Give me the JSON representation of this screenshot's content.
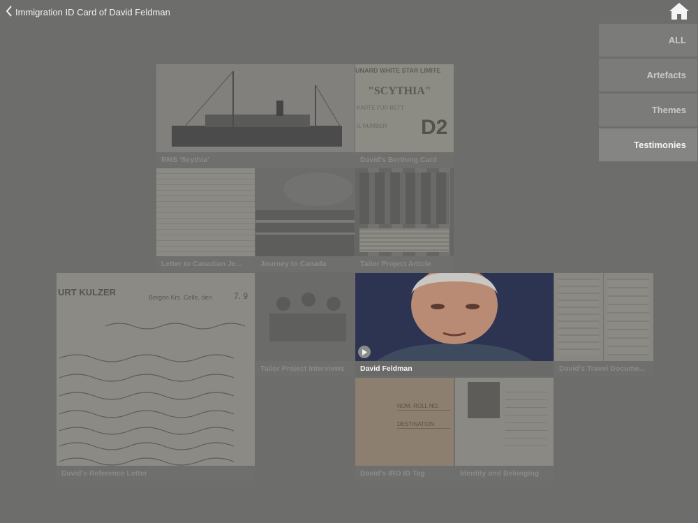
{
  "header": {
    "title": "Immigration ID Card of David Feldman",
    "back_icon": "chevron-left-icon",
    "home_icon": "home-icon"
  },
  "filters": [
    {
      "label": "ALL",
      "active": false
    },
    {
      "label": "Artefacts",
      "active": false
    },
    {
      "label": "Themes",
      "active": false
    },
    {
      "label": "Testimonies",
      "active": true
    }
  ],
  "tiles": {
    "rms_scythia": "RMS 'Scythia'",
    "berthing_card": "David's Berthing Card",
    "berthing_card_text": {
      "line1": "UNARD WHITE STAR LIMITE",
      "line2": "\"SCYTHIA\"",
      "line3": "KARTE FÜR BETT",
      "line4": "IL NUMBER",
      "code": "D2"
    },
    "letter_canadian": "Letter to Canadian Je...",
    "journey_canada": "Journey to Canada",
    "tailor_article": "Tailor Project Article",
    "reference_letter": "David's Reference Letter",
    "reference_letter_text": {
      "header": "URT KULZER",
      "address": "Bergen Krs. Celle, den",
      "date": "7. 9"
    },
    "tailor_interviews": "Tailor Project Interviews",
    "david_feldman": "David Feldman",
    "travel_documents": "David's Travel Docume...",
    "iro_tag": "David's IRO ID Tag",
    "iro_tag_text": {
      "line1": "NOM. ROLL NO.",
      "line2": "DESTINATION"
    },
    "identity_belonging": "Identity and Belonging"
  },
  "colors": {
    "background": "#6d6d6c",
    "highlight_caption_text": "#f6f6f6",
    "faded_caption_text": "#8a8a89"
  }
}
